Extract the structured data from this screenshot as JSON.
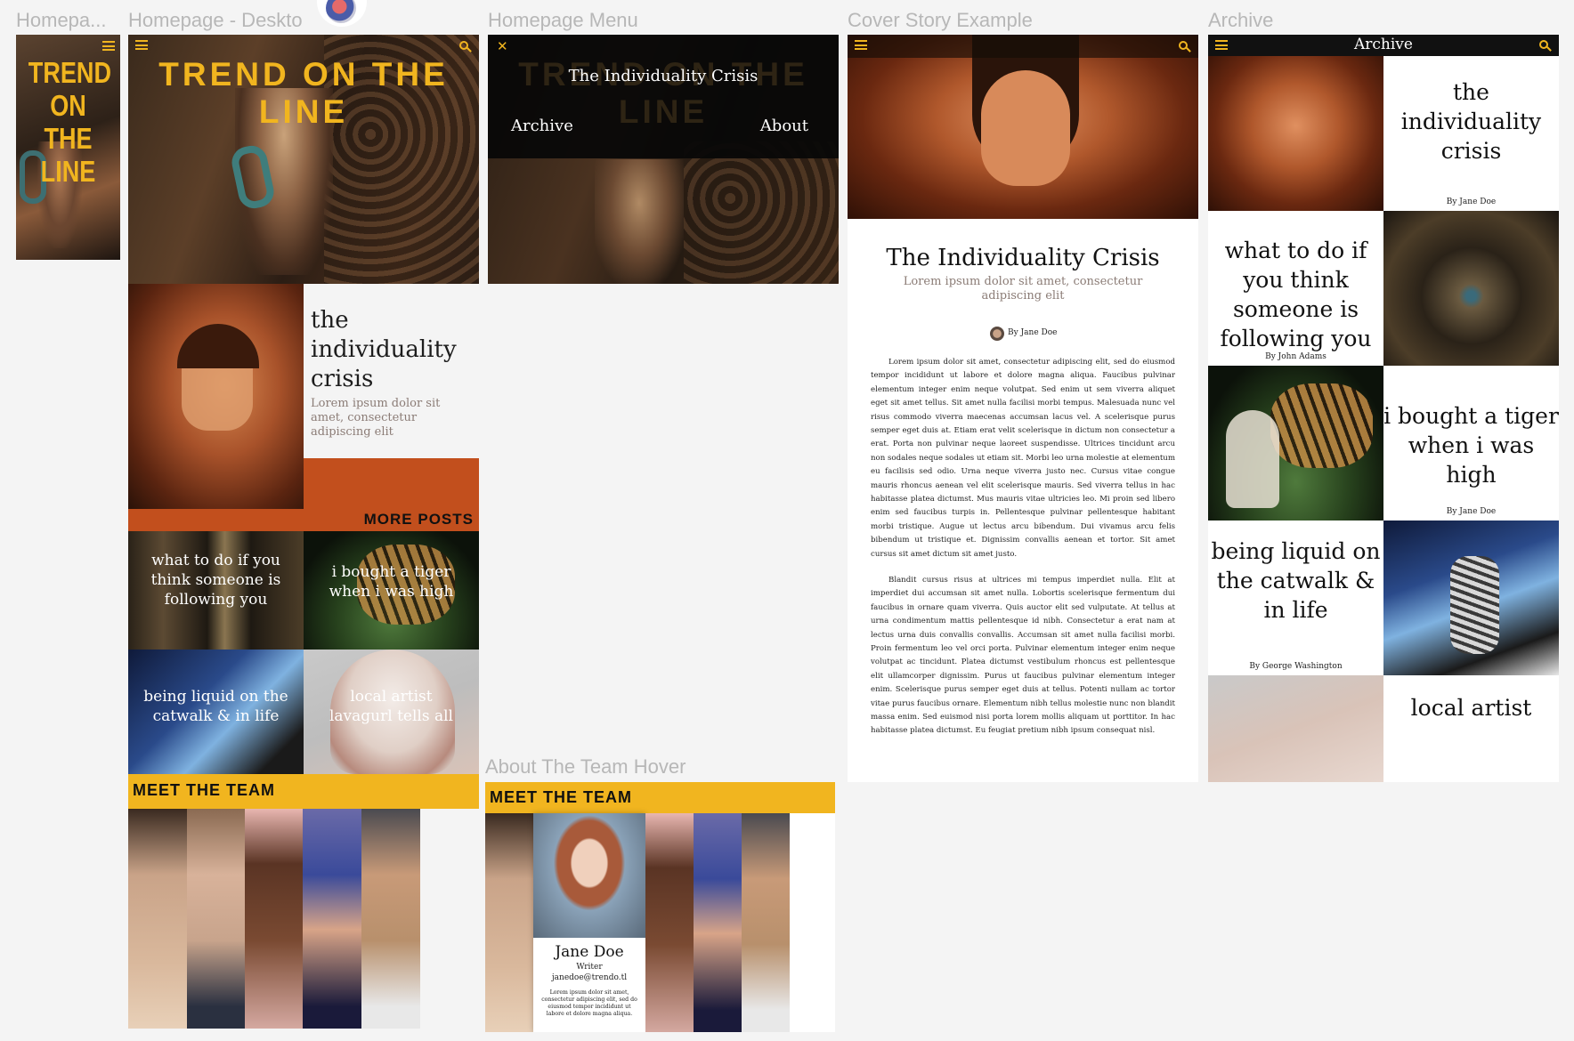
{
  "frames": {
    "mobile": "Homepa...",
    "desktop": "Homepage - Deskto",
    "menu": "Homepage Menu",
    "cover": "Cover Story Example",
    "archive": "Archive",
    "team_hover": "About The Team Hover"
  },
  "mobile": {
    "logo_line1": "TREND",
    "logo_line2": "ON THE",
    "logo_line3": "LINE"
  },
  "desktop": {
    "logo": "TREND ON THE LINE",
    "feature_title": "the individuality crisis",
    "feature_sub": "Lorem ipsum dolor sit amet, consectetur adipiscing elit",
    "more_posts": "MORE POSTS",
    "posts": [
      "what to do if you think someone is following you",
      "i bought a tiger when i was high",
      "being liquid on the catwalk & in life",
      "local artist lavagurl tells all"
    ],
    "meet_team": "MEET THE TEAM"
  },
  "menu": {
    "title": "The Individuality Crisis",
    "bg_logo": "TREND ON THE LINE",
    "archive": "Archive",
    "about": "About"
  },
  "cover": {
    "title": "The Individuality Crisis",
    "subtitle": "Lorem ipsum dolor sit amet, consectetur adipiscing elit",
    "author": "By Jane Doe",
    "para1": "Lorem ipsum dolor sit amet, consectetur adipiscing elit, sed do eiusmod tempor incididunt ut labore et dolore magna aliqua. Faucibus pulvinar elementum integer enim neque volutpat. Sed enim ut sem viverra aliquet eget sit amet tellus. Sit amet nulla facilisi morbi tempus. Malesuada nunc vel risus commodo viverra maecenas accumsan lacus vel. A scelerisque purus semper eget duis at. Etiam erat velit scelerisque in dictum non consectetur a erat. Porta non pulvinar neque laoreet suspendisse. Ultrices tincidunt arcu non sodales neque sodales ut etiam sit. Morbi leo urna molestie at elementum eu facilisis sed odio. Urna neque viverra justo nec. Cursus vitae congue mauris rhoncus aenean vel elit scelerisque mauris. Sed viverra tellus in hac habitasse platea dictumst. Mus mauris vitae ultricies leo. Mi proin sed libero enim sed faucibus turpis in. Pellentesque pulvinar pellentesque habitant morbi tristique. Augue ut lectus arcu bibendum. Dui vivamus arcu felis bibendum ut tristique et. Dignissim convallis aenean et tortor. Sit amet cursus sit amet dictum sit amet justo.",
    "para2": "Blandit cursus risus at ultrices mi tempus imperdiet nulla. Elit at imperdiet dui accumsan sit amet nulla. Lobortis scelerisque fermentum dui faucibus in ornare quam viverra. Quis auctor elit sed vulputate. At tellus at urna condimentum mattis pellentesque id nibh. Consectetur a erat nam at lectus urna duis convallis convallis. Accumsan sit amet nulla facilisi morbi. Proin fermentum leo vel orci porta. Pulvinar elementum integer enim neque volutpat ac tincidunt. Platea dictumst vestibulum rhoncus est pellentesque elit ullamcorper dignissim. Purus ut faucibus pulvinar elementum integer enim. Scelerisque purus semper eget duis at tellus. Potenti nullam ac tortor vitae purus faucibus ornare. Elementum nibh tellus molestie nunc non blandit massa enim. Sed euismod nisi porta lorem mollis aliquam ut porttitor. In hac habitasse platea dictumst. Eu feugiat pretium nibh ipsum consequat nisl."
  },
  "archive": {
    "title": "Archive",
    "items": [
      {
        "title": "the individuality crisis",
        "author": "By Jane Doe"
      },
      {
        "title": "what to do if you think someone is following you",
        "author": "By John Adams"
      },
      {
        "title": "i bought a tiger when i was high",
        "author": "By Jane Doe"
      },
      {
        "title": "being liquid on the catwalk & in life",
        "author": "By George Washington"
      },
      {
        "title": "local artist",
        "author": ""
      }
    ]
  },
  "team_hover": {
    "heading": "MEET THE TEAM",
    "name": "Jane Doe",
    "role": "Writer",
    "email": "janedoe@trendo.tl",
    "bio": "Lorem ipsum dolor sit amet, consectetur adipiscing elit, sed do eiusmod tempor incididunt ut labore et dolore magna aliqua."
  },
  "colors": {
    "accent_yellow": "#f1b51f",
    "rust": "#c24f1d",
    "dark": "#111111",
    "canvas": "#f4f4f4"
  },
  "icons": [
    "hamburger-menu-icon",
    "search-icon",
    "close-icon"
  ]
}
